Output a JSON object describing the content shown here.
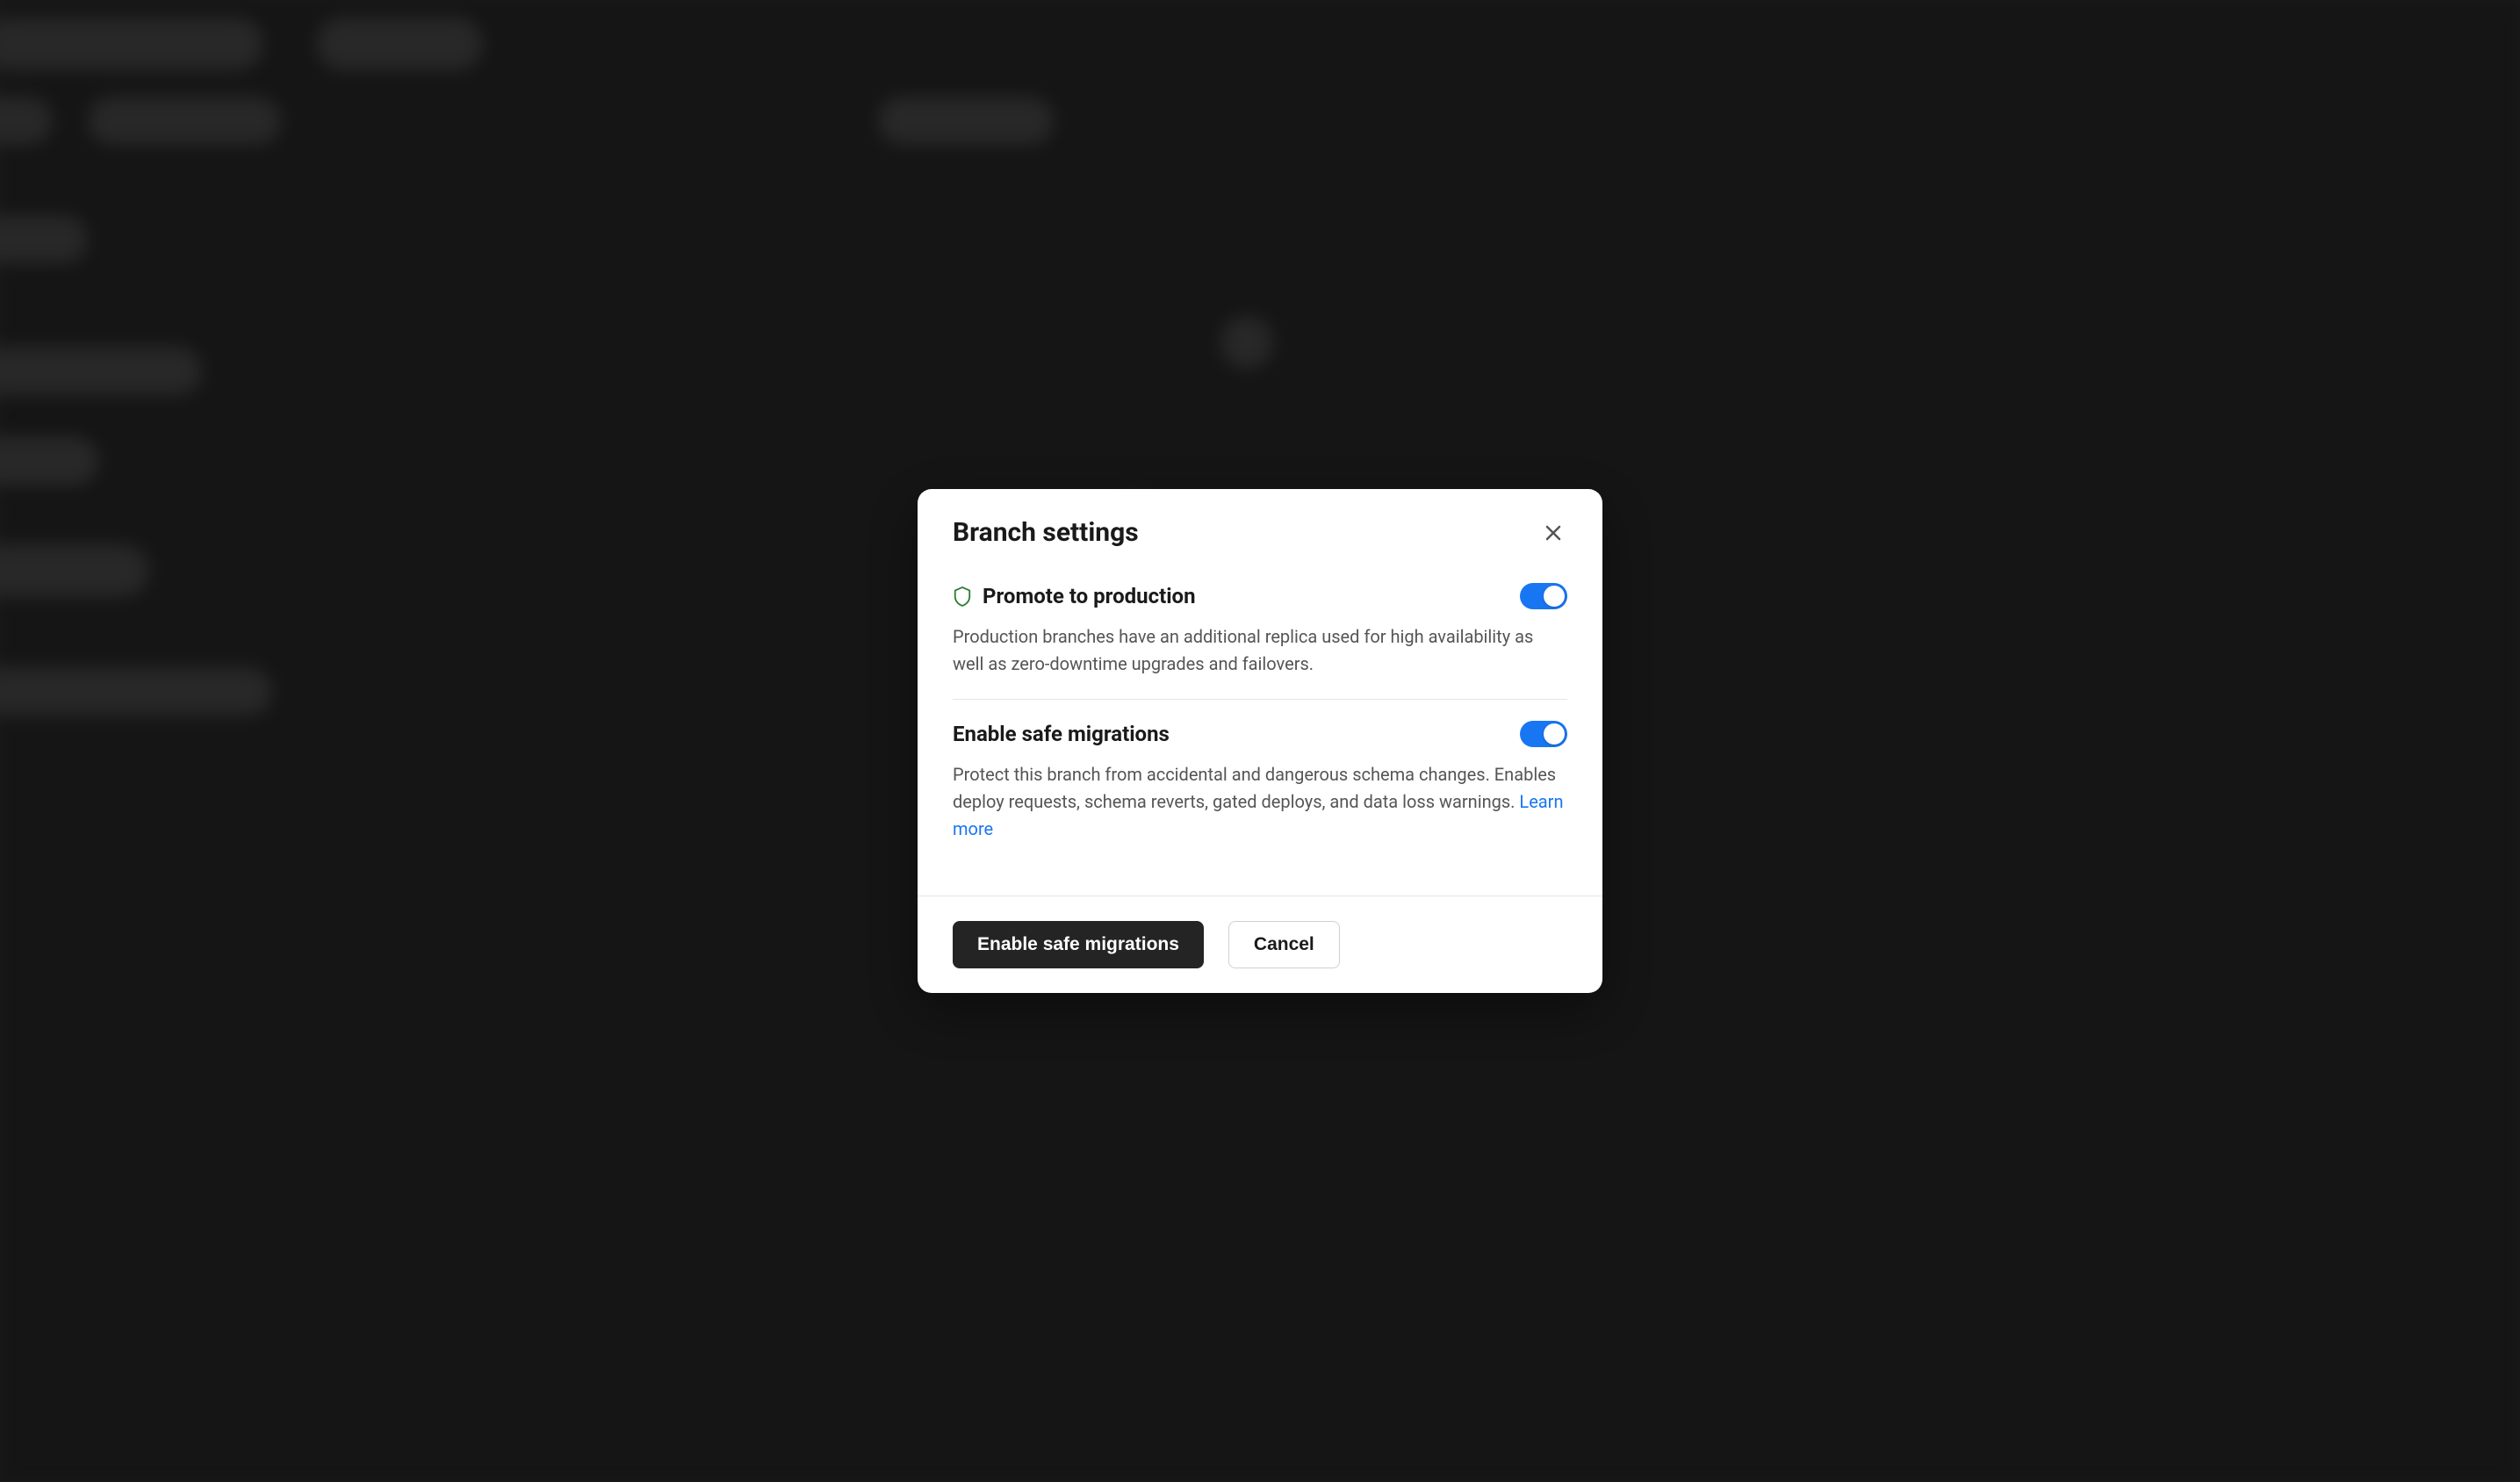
{
  "modal": {
    "title": "Branch settings",
    "sections": [
      {
        "title": "Promote to production",
        "description": "Production branches have an additional replica used for high availability as well as zero-downtime upgrades and failovers.",
        "has_icon": true,
        "toggle_enabled": true
      },
      {
        "title": "Enable safe migrations",
        "description": "Protect this branch from accidental and dangerous schema changes. Enables deploy requests, schema reverts, gated deploys, and data loss warnings. ",
        "learn_more": "Learn more",
        "has_icon": false,
        "toggle_enabled": true
      }
    ],
    "footer": {
      "primary_label": "Enable safe migrations",
      "secondary_label": "Cancel"
    }
  }
}
